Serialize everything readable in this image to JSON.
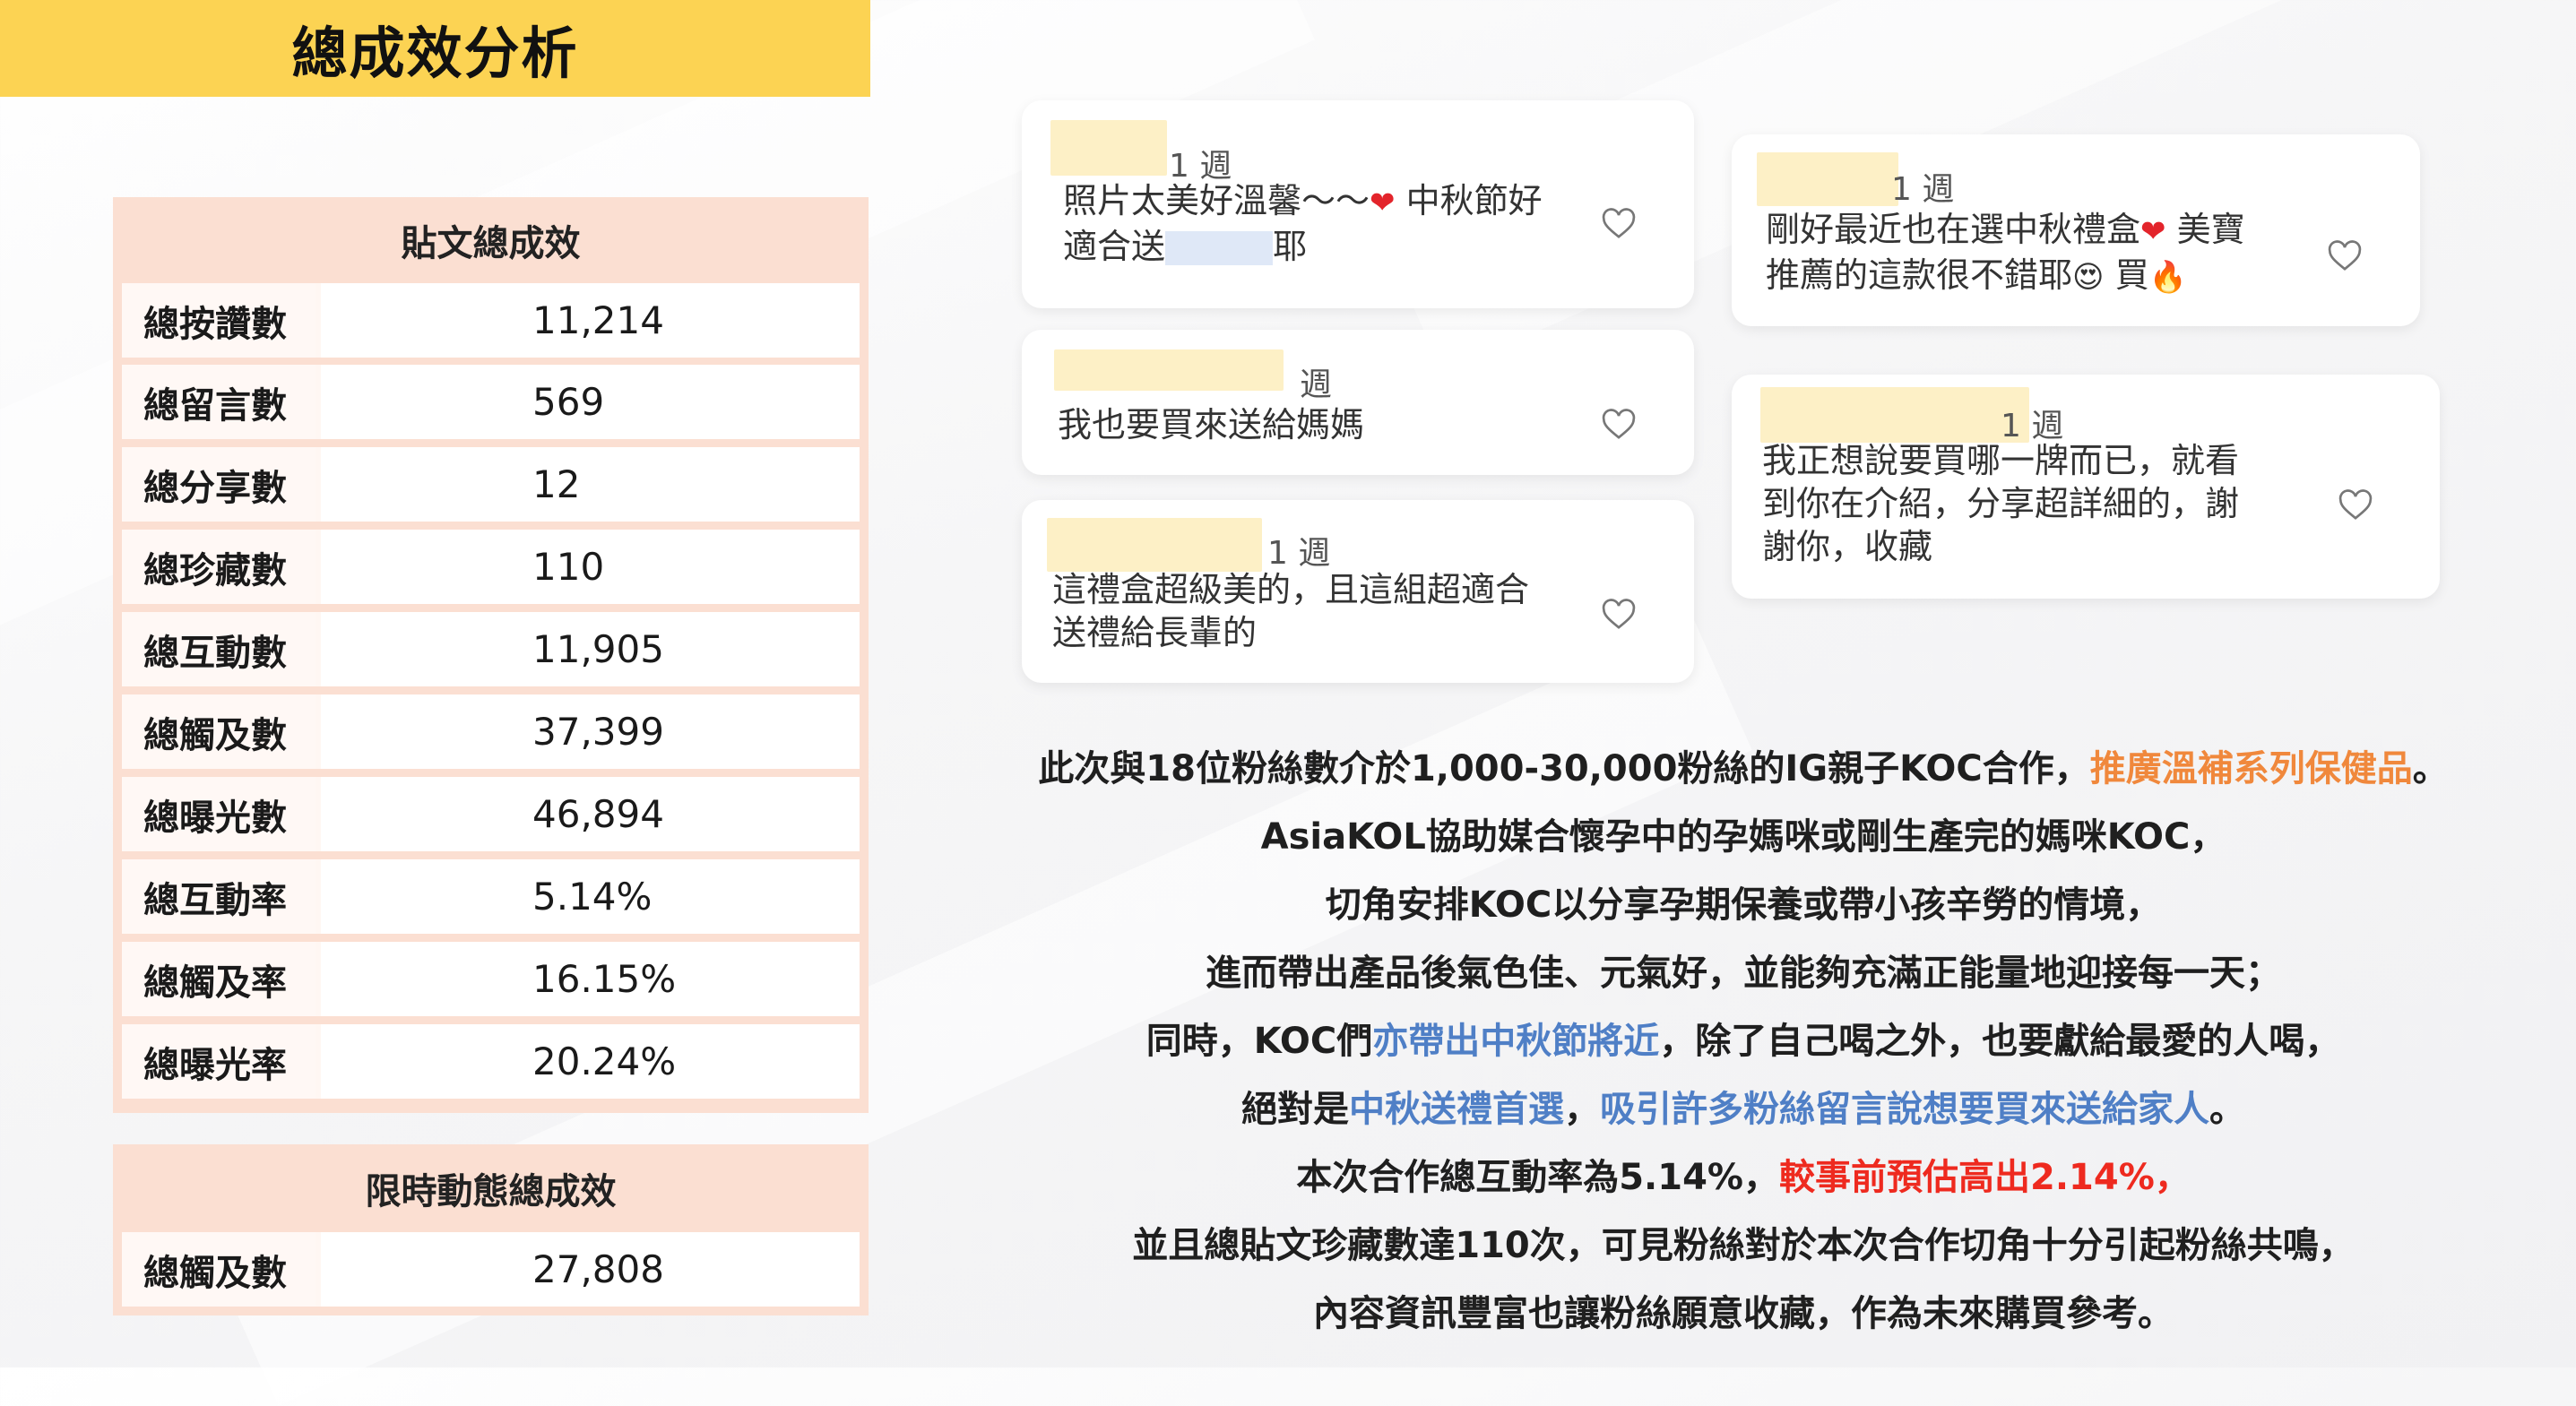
{
  "title": "總成效分析",
  "post_table": {
    "header": "貼文總成效",
    "rows": [
      {
        "label": "總按讚數",
        "value": "11,214"
      },
      {
        "label": "總留言數",
        "value": "569"
      },
      {
        "label": "總分享數",
        "value": "12"
      },
      {
        "label": "總珍藏數",
        "value": "110"
      },
      {
        "label": "總互動數",
        "value": "11,905"
      },
      {
        "label": "總觸及數",
        "value": "37,399"
      },
      {
        "label": "總曝光數",
        "value": "46,894"
      },
      {
        "label": "總互動率",
        "value": "5.14%"
      },
      {
        "label": "總觸及率",
        "value": "16.15%"
      },
      {
        "label": "總曝光率",
        "value": "20.24%"
      }
    ]
  },
  "story_table": {
    "header": "限時動態總成效",
    "rows": [
      {
        "label": "總觸及數",
        "value": "27,808"
      }
    ]
  },
  "comments": [
    {
      "time": "1 週",
      "line1a": "照片太美好溫馨～～",
      "line1b": "中秋節好",
      "line2a": "適合送",
      "line2b": "耶"
    },
    {
      "time": "週",
      "line1": "我也要買來送給媽媽"
    },
    {
      "time": "1 週",
      "line1": "這禮盒超級美的，且這組超適合",
      "line2": "送禮給長輩的"
    },
    {
      "time": "1 週",
      "line1a": "剛好最近也在選中秋禮盒",
      "line1b": "美寶",
      "line2a": "推薦的這款很不錯耶",
      "line2b": "買"
    },
    {
      "time": "1 週",
      "line1": "我正想說要買哪一牌而已，就看",
      "line2": "到你在介紹，分享超詳細的，謝",
      "line3": "謝你，收藏"
    }
  ],
  "paragraph": {
    "l1a": "此次與18位粉絲數介於1,000-30,000粉絲的IG親子KOC合作，",
    "l1b": "推廣溫補系列保健品",
    "l1c": "。",
    "l2": "AsiaKOL協助媒合懷孕中的孕媽咪或剛生產完的媽咪KOC，",
    "l3": "切角安排KOC以分享孕期保養或帶小孩辛勞的情境，",
    "l4": "進而帶出產品後氣色佳、元氣好，並能夠充滿正能量地迎接每一天；",
    "l5a": "同時，KOC們",
    "l5b": "亦帶出中秋節將近",
    "l5c": "，除了自己喝之外，也要獻給最愛的人喝，",
    "l6a": "絕對是",
    "l6b": "中秋送禮首選",
    "l6c": "，",
    "l6d": "吸引許多粉絲留言說想要買來送給家人",
    "l6e": "。",
    "l7a": "本次合作總互動率為5.14%，",
    "l7b": "較事前預估高出2.14%，",
    "l8": "並且總貼文珍藏數達110次，可見粉絲對於本次合作切角十分引起粉絲共鳴，",
    "l9": "內容資訊豐富也讓粉絲願意收藏，作為未來購買參考。"
  },
  "colors": {
    "title_bg": "#fcd353",
    "table_bg": "#fbdfd2",
    "orange": "#f0883c",
    "blue": "#4f7fc6",
    "red": "#ee2a1f"
  },
  "icons": [
    "heart-outline-icon",
    "red-heart-emoji",
    "heart-eyes-emoji",
    "fire-emoji"
  ]
}
